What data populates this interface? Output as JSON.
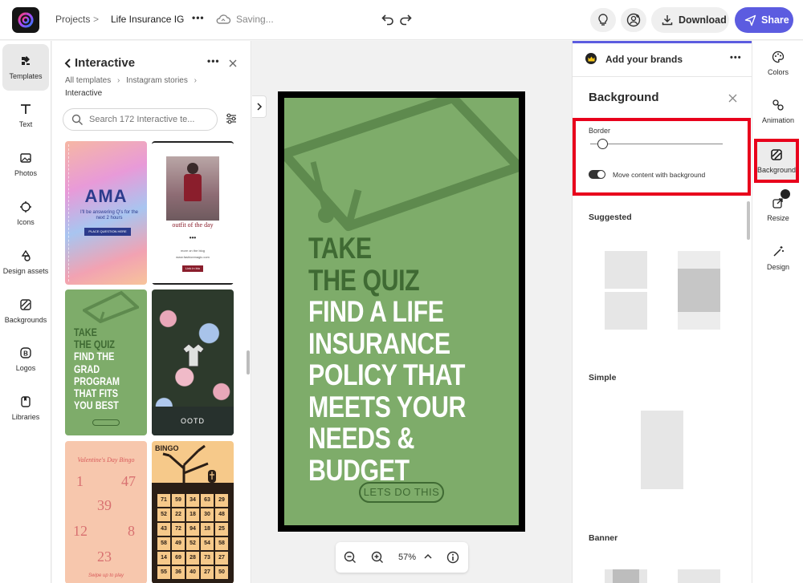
{
  "topbar": {
    "projects_label": "Projects",
    "chevron": ">",
    "doc_title": "Life Insurance IG",
    "more": "•••",
    "status": "Saving...",
    "download_label": "Download",
    "share_label": "Share"
  },
  "left_rail": [
    {
      "label": "Templates"
    },
    {
      "label": "Text"
    },
    {
      "label": "Photos"
    },
    {
      "label": "Icons"
    },
    {
      "label": "Design assets"
    },
    {
      "label": "Backgrounds"
    },
    {
      "label": "Logos"
    },
    {
      "label": "Libraries"
    }
  ],
  "panel": {
    "title": "Interactive",
    "crumb_root": "All templates",
    "crumb_mid": "Instagram stories",
    "crumb_current": "Interactive",
    "search_placeholder": "Search 172 Interactive te...",
    "more": "•••"
  },
  "thumbs": {
    "ama_title": "AMA",
    "ama_sub": "I'll be answering Q's for the next 2 hours",
    "ama_btn": "PLACE QUESTION HERE",
    "ootd_small": "outfit of the day",
    "ootd_more": "•••",
    "ootd_line1": "more on the blog",
    "ootd_line2": "www.fashionmagic.com",
    "ootd_btn": "Link in bio",
    "grad_text": [
      "TAKE",
      "THE QUIZ",
      "FIND THE",
      "GRAD",
      "PROGRAM",
      "THAT FITS",
      "YOU BEST"
    ],
    "floral_label": "OOTD",
    "valentine_title": "Valentine's Day Bingo",
    "valentine_nums": [
      "1",
      "47",
      "39",
      "12",
      "8",
      "23"
    ],
    "valentine_foot": "Swipe up to play",
    "bingo_title": "BINGO",
    "bingo_cells": [
      "71",
      "59",
      "34",
      "63",
      "29",
      "52",
      "22",
      "18",
      "30",
      "48",
      "43",
      "72",
      "94",
      "18",
      "25",
      "58",
      "49",
      "52",
      "54",
      "58",
      "14",
      "69",
      "28",
      "73",
      "27",
      "55",
      "36",
      "40",
      "27",
      "50"
    ]
  },
  "poster": {
    "lines_dark": [
      "TAKE",
      "THE QUIZ"
    ],
    "lines_white": [
      "FIND A LIFE",
      "INSURANCE",
      "POLICY THAT",
      "MEETS YOUR",
      "NEEDS &",
      "BUDGET"
    ],
    "cta": "LETS DO THIS"
  },
  "zoom": {
    "value": "57%"
  },
  "right_panel": {
    "brands_label": "Add your brands",
    "more": "•••",
    "section_title": "Background",
    "border_label": "Border",
    "border_value": 0.09,
    "toggle_label": "Move content with background",
    "toggle_on": true,
    "suggested_label": "Suggested",
    "simple_label": "Simple",
    "banner_label": "Banner"
  },
  "right_rail": [
    {
      "label": "Colors"
    },
    {
      "label": "Animation"
    },
    {
      "label": "Background"
    },
    {
      "label": "Resize"
    },
    {
      "label": "Design"
    }
  ],
  "colors": {
    "share": "#5c5ce0",
    "poster_green": "#7eac6a",
    "poster_dark": "#3f6a33",
    "highlight_red": "#e8001c"
  }
}
